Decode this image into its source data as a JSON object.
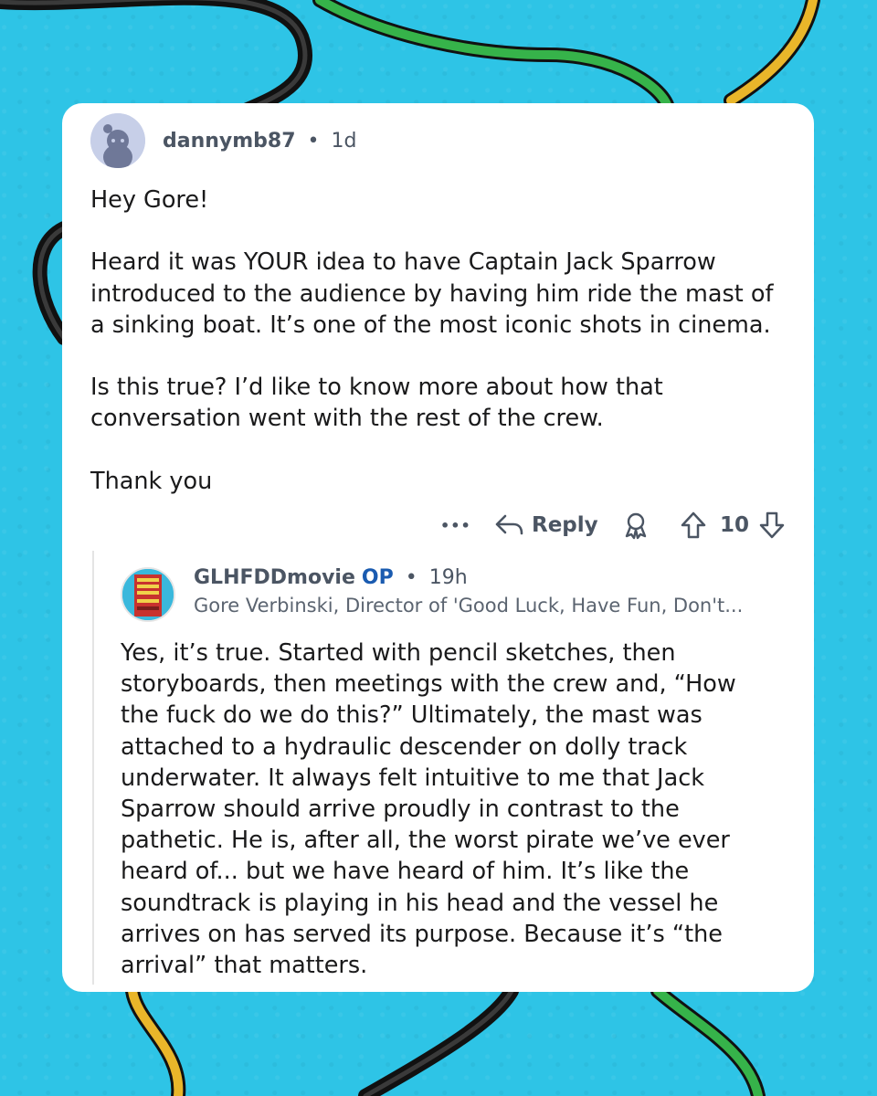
{
  "comment": {
    "username": "dannymb87",
    "separator": "•",
    "age": "1d",
    "body": "Hey Gore!\n\nHeard it was YOUR idea to have Captain Jack Sparrow introduced to the audience by having him ride the mast of a sinking boat.  It’s one of the most iconic shots in cinema.\n\nIs this true?  I’d like to know more about how that conversation went with the rest of the crew.\n\nThank you",
    "actions": {
      "more_label": "•••",
      "reply_label": "Reply",
      "score": "10",
      "icons": [
        "reply-arrow-icon",
        "award-icon",
        "upvote-icon",
        "downvote-icon"
      ]
    }
  },
  "reply": {
    "username": "GLHFDDmovie",
    "op_badge": "OP",
    "separator": "•",
    "age": "19h",
    "flair": "Gore Verbinski, Director of 'Good Luck, Have Fun, Don't...",
    "body": "Yes, it’s true. Started with pencil sketches, then storyboards, then meetings with the crew and, “How the fuck do we do this?” Ultimately, the mast was attached to a hydraulic descender on dolly track underwater. It always felt intuitive to me that Jack Sparrow should arrive proudly in contrast to the pathetic. He is, after all, the worst pirate we’ve ever heard of... but we have heard of him. It’s like the soundtrack is playing in his head and the vessel he arrives on has served its purpose. Because it’s “the arrival” that matters."
  },
  "colors": {
    "background": "#2ec4e6",
    "card": "#ffffff",
    "op_badge": "#1a5bb0",
    "meta_text": "#4b5563"
  }
}
